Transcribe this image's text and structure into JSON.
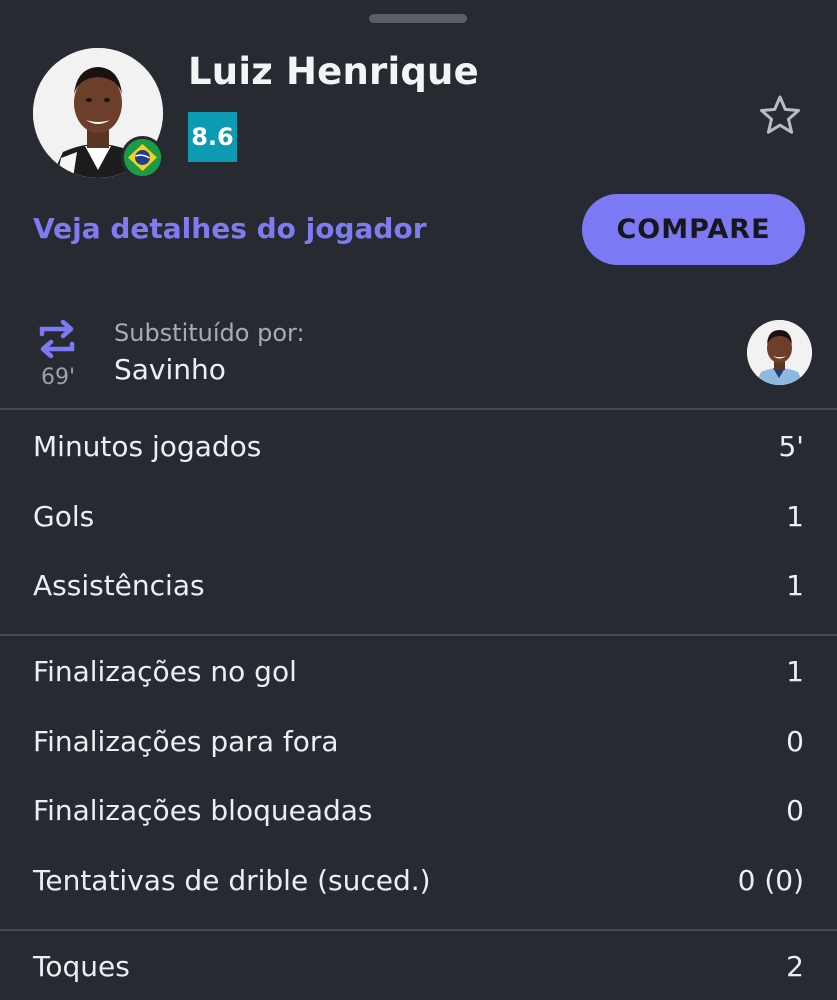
{
  "player": {
    "name": "Luiz Henrique",
    "rating": "8.6",
    "rating_color": "#0c9bb2",
    "nationality_flag_icon": "brazil-flag-icon",
    "favorite_icon": "star-outline-icon"
  },
  "actions": {
    "details_link": "Veja detalhes do jogador",
    "compare_button": "COMPARE",
    "accent_color": "#7b79f4"
  },
  "substitution": {
    "icon": "swap-arrows-icon",
    "minute": "69'",
    "label": "Substituído por:",
    "player_name": "Savinho"
  },
  "stat_groups": [
    {
      "rows": [
        {
          "label": "Minutos jogados",
          "value": "5'"
        },
        {
          "label": "Gols",
          "value": "1"
        },
        {
          "label": "Assistências",
          "value": "1"
        }
      ]
    },
    {
      "rows": [
        {
          "label": "Finalizações no gol",
          "value": "1"
        },
        {
          "label": "Finalizações para fora",
          "value": "0"
        },
        {
          "label": "Finalizações bloqueadas",
          "value": "0"
        },
        {
          "label": "Tentativas de drible (suced.)",
          "value": "0 (0)"
        }
      ]
    },
    {
      "rows": [
        {
          "label": "Toques",
          "value": "2"
        }
      ]
    }
  ]
}
